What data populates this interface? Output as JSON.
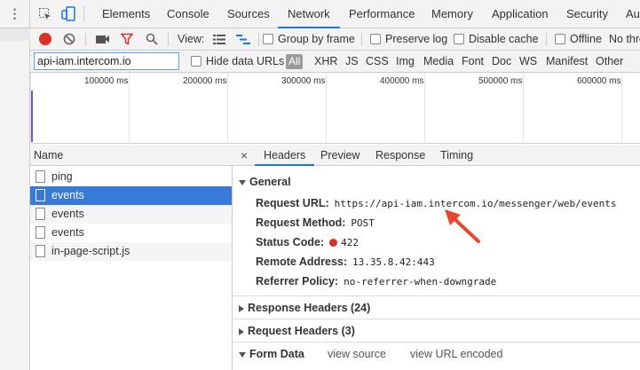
{
  "tabs": [
    "Elements",
    "Console",
    "Sources",
    "Network",
    "Performance",
    "Memory",
    "Application",
    "Security",
    "Aud"
  ],
  "toolbar": {
    "view_label": "View:",
    "group_by_frame": "Group by frame",
    "preserve_log": "Preserve log",
    "disable_cache": "Disable cache",
    "offline": "Offline",
    "throttle": "No thro"
  },
  "filter": {
    "value": "api-iam.intercom.io",
    "hide_data_urls": "Hide data URLs",
    "types": [
      "All",
      "XHR",
      "JS",
      "CSS",
      "Img",
      "Media",
      "Font",
      "Doc",
      "WS",
      "Manifest",
      "Other"
    ]
  },
  "timeline": {
    "ticks": [
      "100000 ms",
      "200000 ms",
      "300000 ms",
      "400000 ms",
      "500000 ms",
      "600000 ms"
    ]
  },
  "requests": {
    "column_header": "Name",
    "items": [
      "ping",
      "events",
      "events",
      "events",
      "in-page-script.js"
    ]
  },
  "detail": {
    "close": "×",
    "tabs": [
      "Headers",
      "Preview",
      "Response",
      "Timing"
    ],
    "general": {
      "title": "General",
      "request_url_label": "Request URL:",
      "request_url": "https://api-iam.intercom.io/messenger/web/events",
      "method_label": "Request Method:",
      "method": "POST",
      "status_label": "Status Code:",
      "status": "422",
      "remote_label": "Remote Address:",
      "remote": "13.35.8.42:443",
      "referrer_label": "Referrer Policy:",
      "referrer": "no-referrer-when-downgrade"
    },
    "response_headers": "Response Headers (24)",
    "request_headers": "Request Headers (3)",
    "form_data": "Form Data",
    "view_source": "view source",
    "view_url_encoded": "view URL encoded"
  },
  "colors": {
    "accent": "#1a73e8",
    "selected_row": "#3879d9",
    "status_error": "#d93025",
    "annotation_arrow": "#e8472e"
  }
}
